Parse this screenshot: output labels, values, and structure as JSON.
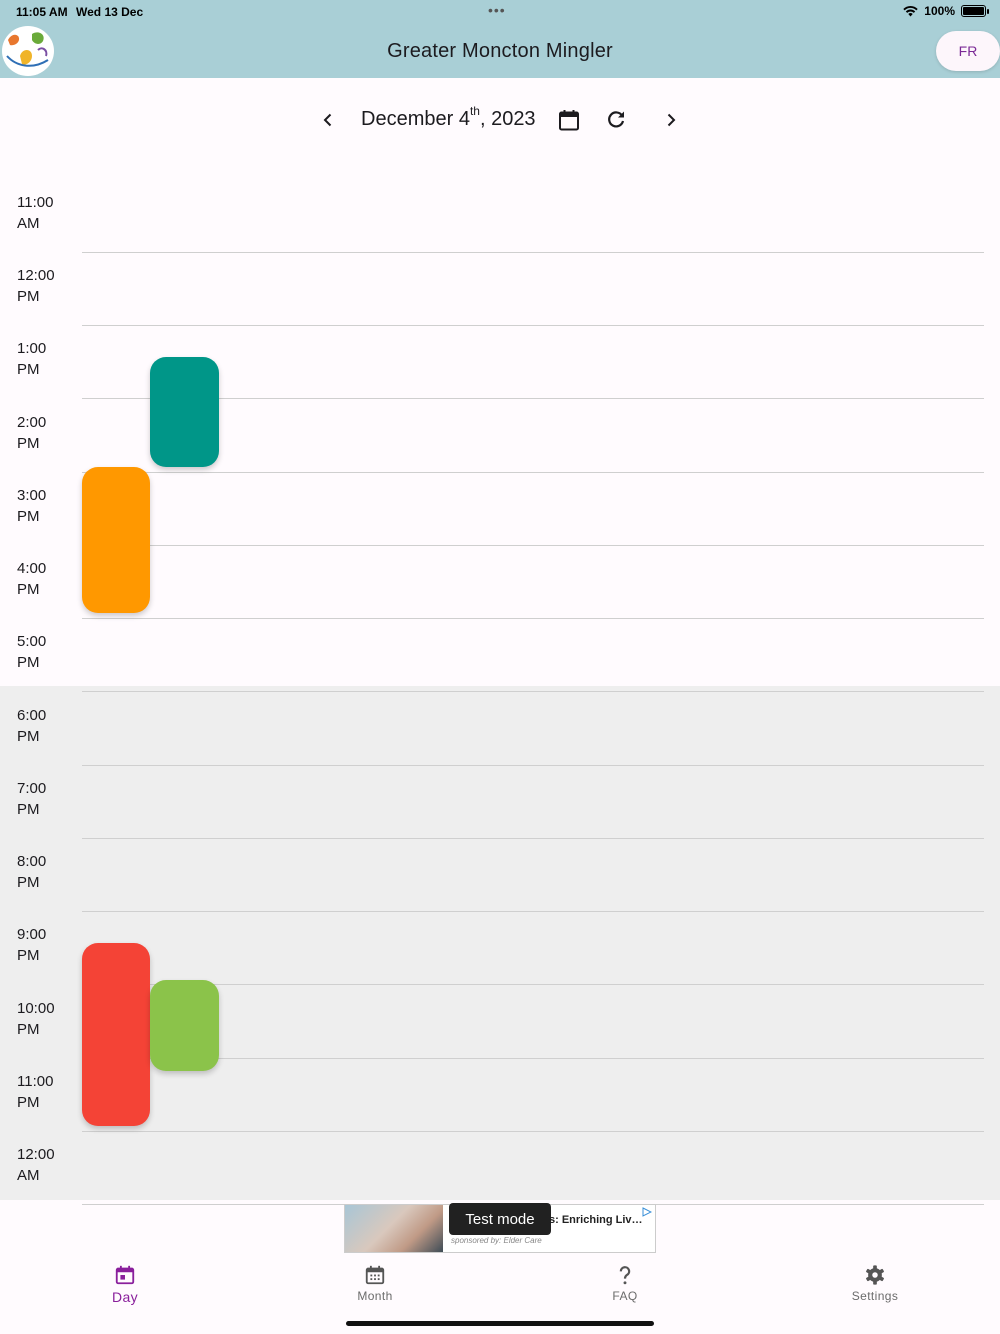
{
  "status_bar": {
    "time": "11:05 AM",
    "date": "Wed 13 Dec",
    "battery": "100%",
    "battery_level": 1.0
  },
  "app_bar": {
    "title": "Greater Moncton Mingler",
    "lang_button": "FR"
  },
  "date_nav": {
    "month_day": "December 4",
    "suffix": "th",
    "year": ", 2023"
  },
  "timeline": {
    "hours": [
      {
        "time": "11:00",
        "period": "AM"
      },
      {
        "time": "12:00",
        "period": "PM"
      },
      {
        "time": "1:00",
        "period": "PM"
      },
      {
        "time": "2:00",
        "period": "PM"
      },
      {
        "time": "3:00",
        "period": "PM"
      },
      {
        "time": "4:00",
        "period": "PM"
      },
      {
        "time": "5:00",
        "period": "PM"
      },
      {
        "time": "6:00",
        "period": "PM"
      },
      {
        "time": "7:00",
        "period": "PM"
      },
      {
        "time": "8:00",
        "period": "PM"
      },
      {
        "time": "9:00",
        "period": "PM"
      },
      {
        "time": "10:00",
        "period": "PM"
      },
      {
        "time": "11:00",
        "period": "PM"
      },
      {
        "time": "12:00",
        "period": "AM"
      }
    ],
    "events": [
      {
        "color": "#009688"
      },
      {
        "color": "#ff9800"
      },
      {
        "color": "#f44336"
      },
      {
        "color": "#8bc34a"
      }
    ]
  },
  "ad": {
    "title": "s: Enriching Liv…",
    "sponsor": "sponsored by: Elder Care",
    "test_mode": "Test mode"
  },
  "bottom_nav": {
    "items": [
      {
        "label": "Day",
        "icon": "calendar-today-icon",
        "active": true
      },
      {
        "label": "Month",
        "icon": "calendar-month-icon",
        "active": false
      },
      {
        "label": "FAQ",
        "icon": "question-mark-icon",
        "active": false
      },
      {
        "label": "Settings",
        "icon": "gear-icon",
        "active": false
      }
    ]
  },
  "colors": {
    "app_bar": "#a9cfd6",
    "accent": "#8a1f9c",
    "evening_bg": "#eeeeee"
  }
}
